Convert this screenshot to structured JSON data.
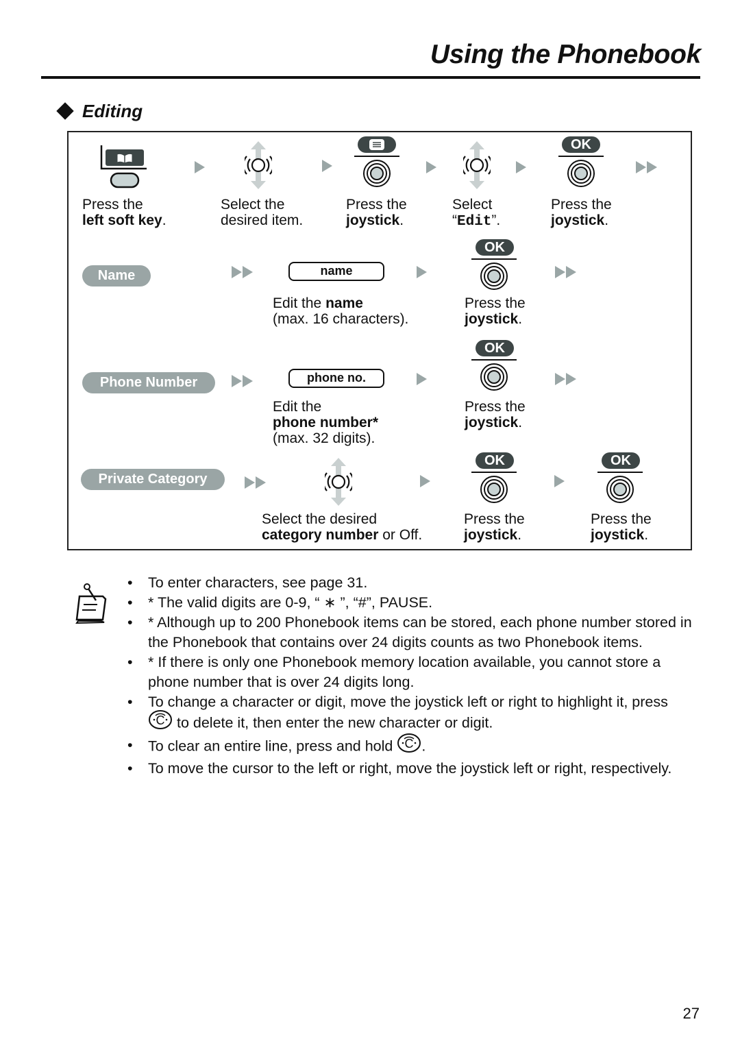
{
  "header": {
    "title": "Using the Phonebook"
  },
  "section": {
    "title": "Editing"
  },
  "steps_top": [
    {
      "icon": "left-soft-key-icon",
      "line1": "Press the",
      "line2_bold": "left soft key",
      "line2_after": "."
    },
    {
      "icon": "joystick-up-down-icon",
      "line1": "Select the",
      "line2": "desired item."
    },
    {
      "icon": "joystick-press-icon",
      "key_label": "menu",
      "line1": "Press the",
      "line2_bold": "joystick",
      "line2_after": "."
    },
    {
      "icon": "joystick-up-down-icon",
      "line1": "Select",
      "line2_before": "“",
      "line2_mono": "Edit",
      "line2_after": "”."
    },
    {
      "icon": "joystick-press-icon",
      "key_label": "OK",
      "line1": "Press the",
      "line2_bold": "joystick",
      "line2_after": "."
    }
  ],
  "rows": {
    "name": {
      "label": "Name",
      "field": "name",
      "edit_before": "Edit the ",
      "edit_bold": "name",
      "edit_line2": "(max. 16 characters).",
      "ok_label": "OK",
      "press_line1": "Press the",
      "press_bold": "joystick",
      "press_after": "."
    },
    "phone": {
      "label": "Phone Number",
      "field": "phone no.",
      "edit_line1": "Edit the",
      "edit_bold": "phone number*",
      "edit_line3": "(max. 32 digits).",
      "ok_label": "OK",
      "press_line1": "Press the",
      "press_bold": "joystick",
      "press_after": "."
    },
    "category": {
      "label": "Private Category",
      "select_line1": "Select the desired",
      "select_bold": "category number",
      "select_after": " or Off.",
      "ok1_label": "OK",
      "press1_line1": "Press the",
      "press1_bold": "joystick",
      "press1_after": ".",
      "ok2_label": "OK",
      "press2_line1": "Press the",
      "press2_bold": "joystick",
      "press2_after": "."
    }
  },
  "notes": {
    "icon": "memo-note-icon",
    "items": [
      {
        "bullet": "•",
        "text": "To enter characters, see page 31."
      },
      {
        "bullet": "•",
        "text_before": "* The valid digits are 0-9, “ ",
        "symbol": "∗",
        "text_after": " ”, “#”, PAUSE."
      },
      {
        "bullet": "•",
        "text": "* Although up to 200 Phonebook items can be stored, each phone number stored in the Phonebook that contains over 24 digits counts as two Phonebook items."
      },
      {
        "bullet": "•",
        "text": "* If there is only one Phonebook memory location available, you cannot store a phone number that is over 24 digits long."
      },
      {
        "bullet": "•",
        "text_line1": "To change a character or digit, move the joystick left or right to highlight it, press",
        "text_line2_after": " to delete it, then enter the new character or digit."
      },
      {
        "bullet": "•",
        "text_before": "To clear an entire line, press and hold ",
        "text_after": "."
      },
      {
        "bullet": "•",
        "text": "To move the cursor to the left or right, move the joystick left or right, respectively."
      }
    ]
  },
  "footer": {
    "page_number": "27"
  }
}
